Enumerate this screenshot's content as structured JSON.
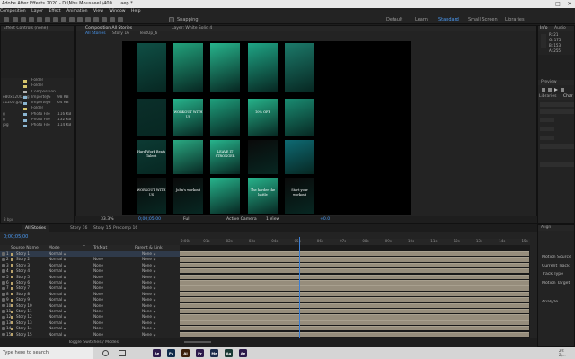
{
  "window": {
    "title": "Adobe After Effects 2020 - D:\\Nhu Mousaeel \\400 ... .aep *"
  },
  "menubar": [
    "Composition",
    "Layer",
    "Effect",
    "Animation",
    "View",
    "Window",
    "Help"
  ],
  "toolbar": {
    "snapping_label": "Snapping",
    "workspaces": [
      "Default",
      "Learn",
      "Standard",
      "Small Screen",
      "Libraries"
    ],
    "active_workspace": "Standard"
  },
  "project": {
    "title": "Effect Controls (none)",
    "items": [
      {
        "name": "",
        "type": "Folder",
        "size": "",
        "color": "#d6c56d"
      },
      {
        "name": "",
        "type": "Folder",
        "size": "",
        "color": "#d6c56d"
      },
      {
        "name": "",
        "type": "Composition",
        "size": "",
        "color": "#b3b3b3"
      },
      {
        "name": "e80x1200.jpg",
        "type": "ImporteJG",
        "size": "98 KB",
        "color": "#8ab5d1"
      },
      {
        "name": "x1200.jpg",
        "type": "ImporteJG",
        "size": "64 KB",
        "color": "#8ab5d1"
      },
      {
        "name": "",
        "type": "Folder",
        "size": "",
        "color": "#d6c56d"
      },
      {
        "name": "g",
        "type": "Photo File",
        "size": "116 KB",
        "color": "#8ab5d1"
      },
      {
        "name": "g",
        "type": "Photo File",
        "size": "132 KB",
        "color": "#8ab5d1"
      },
      {
        "name": "jpg",
        "type": "Photo File",
        "size": "114 KB",
        "color": "#8ab5d1"
      }
    ],
    "footer": "8 bpc"
  },
  "composition": {
    "tabs": [
      "Composition All Stories",
      "Layer: White Solid 4"
    ],
    "breadcrumbs": [
      "All Stories",
      "Story 16",
      "TextUp_6"
    ],
    "zoom": "33.3%",
    "timecode": "0;00;05;00",
    "resolution": "Full",
    "camera": "Active Camera",
    "views": "1 View",
    "offset": "+0.0"
  },
  "thumbs": [
    {
      "bg": "#0f4f45",
      "text": ""
    },
    {
      "bg": "#22a27c",
      "text": ""
    },
    {
      "bg": "#27b48c",
      "text": ""
    },
    {
      "bg": "#1fa585",
      "text": ""
    },
    {
      "bg": "#1c7a6a",
      "text": ""
    },
    {
      "bg": "#0b2f2a",
      "text": ""
    },
    {
      "bg": "#27b48c",
      "text": "WORKOUT WITH US"
    },
    {
      "bg": "#1f9f7c",
      "text": ""
    },
    {
      "bg": "#26b38a",
      "text": "10% OFF"
    },
    {
      "bg": "#1a8c72",
      "text": ""
    },
    {
      "bg": "#0c3a33",
      "text": "Hard Work Beats Talent"
    },
    {
      "bg": "#2aa982",
      "text": ""
    },
    {
      "bg": "#27b48c",
      "text": "LEAVE IT STRONGER"
    },
    {
      "bg": "#0a0a0a",
      "text": ""
    },
    {
      "bg": "#0e6a73",
      "text": ""
    },
    {
      "bg": "#0a0a0a",
      "text": "WORKOUT WITH US"
    },
    {
      "bg": "#0a0a0a",
      "text": "John's workout"
    },
    {
      "bg": "#27b48c",
      "text": ""
    },
    {
      "bg": "#27b48c",
      "text": "The harder the battle"
    },
    {
      "bg": "#0a0a0a",
      "text": "Start your workout"
    }
  ],
  "info_panel": {
    "tabs": [
      "Info",
      "Audio"
    ],
    "values": [
      "R: 21",
      "G: 175",
      "B: 153",
      "A: 255"
    ],
    "preview": "Preview",
    "libraries": "Libraries",
    "character": "Char"
  },
  "timeline": {
    "tabs": [
      "All Stories",
      "Story 16",
      "Story 15",
      "Precomp 16"
    ],
    "timecode": "0;00;05;00",
    "columns": [
      "Source Name",
      "Mode",
      "T",
      "TrkMat",
      "Parent & Link"
    ],
    "layers": [
      {
        "idx": "1",
        "name": "Story 1",
        "mode": "Normal",
        "trkmat": "",
        "parent": "None"
      },
      {
        "idx": "2",
        "name": "Story 2",
        "mode": "Normal",
        "trkmat": "None",
        "parent": "None"
      },
      {
        "idx": "3",
        "name": "Story 3",
        "mode": "Normal",
        "trkmat": "None",
        "parent": "None"
      },
      {
        "idx": "4",
        "name": "Story 4",
        "mode": "Normal",
        "trkmat": "None",
        "parent": "None"
      },
      {
        "idx": "5",
        "name": "Story 5",
        "mode": "Normal",
        "trkmat": "None",
        "parent": "None"
      },
      {
        "idx": "6",
        "name": "Story 6",
        "mode": "Normal",
        "trkmat": "None",
        "parent": "None"
      },
      {
        "idx": "7",
        "name": "Story 7",
        "mode": "Normal",
        "trkmat": "None",
        "parent": "None"
      },
      {
        "idx": "8",
        "name": "Story 8",
        "mode": "Normal",
        "trkmat": "None",
        "parent": "None"
      },
      {
        "idx": "9",
        "name": "Story 9",
        "mode": "Normal",
        "trkmat": "None",
        "parent": "None"
      },
      {
        "idx": "10",
        "name": "Story 10",
        "mode": "Normal",
        "trkmat": "None",
        "parent": "None"
      },
      {
        "idx": "11",
        "name": "Story 11",
        "mode": "Normal",
        "trkmat": "None",
        "parent": "None"
      },
      {
        "idx": "12",
        "name": "Story 12",
        "mode": "Normal",
        "trkmat": "None",
        "parent": "None"
      },
      {
        "idx": "13",
        "name": "Story 13",
        "mode": "Normal",
        "trkmat": "None",
        "parent": "None"
      },
      {
        "idx": "14",
        "name": "Story 14",
        "mode": "Normal",
        "trkmat": "None",
        "parent": "None"
      },
      {
        "idx": "15",
        "name": "Story 15",
        "mode": "Normal",
        "trkmat": "None",
        "parent": "None"
      }
    ],
    "ruler": [
      "0:00s",
      "01s",
      "02s",
      "03s",
      "04s",
      "05s",
      "06s",
      "07s",
      "08s",
      "09s",
      "10s",
      "11s",
      "12s",
      "13s",
      "14s",
      "15s"
    ],
    "footer": "Toggle Switches / Modes"
  },
  "side_panels": {
    "labels": [
      "Align",
      "Motion Source",
      "Current Track",
      "Track Type",
      "Motion Target",
      "Analyze"
    ]
  },
  "taskbar": {
    "search_placeholder": "Type here to search",
    "apps": [
      "Ae",
      "Ps",
      "Ai",
      "Pr",
      "Me",
      "Au",
      "Ae"
    ],
    "clock": "20:\n2/..."
  }
}
